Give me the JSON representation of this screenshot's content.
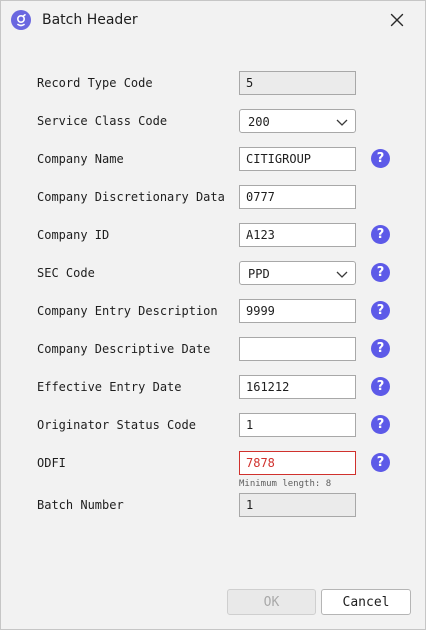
{
  "dialog": {
    "title": "Batch Header",
    "icon": "app-logo-icon",
    "close_icon": "close-icon"
  },
  "fields": {
    "record_type_code": {
      "label": "Record Type Code",
      "value": "5"
    },
    "service_class_code": {
      "label": "Service Class Code",
      "value": "200"
    },
    "company_name": {
      "label": "Company Name",
      "value": "CITIGROUP"
    },
    "company_discretionary_data": {
      "label": "Company Discretionary Data",
      "value": "0777"
    },
    "company_id": {
      "label": "Company ID",
      "value": "A123"
    },
    "sec_code": {
      "label": "SEC Code",
      "value": "PPD"
    },
    "company_entry_description": {
      "label": "Company Entry Description",
      "value": "9999"
    },
    "company_descriptive_date": {
      "label": "Company Descriptive Date",
      "value": ""
    },
    "effective_entry_date": {
      "label": "Effective Entry Date",
      "value": "161212"
    },
    "originator_status_code": {
      "label": "Originator Status Code",
      "value": "1"
    },
    "odfi": {
      "label": "ODFI",
      "value": "7878",
      "hint": "Minimum length: 8"
    },
    "batch_number": {
      "label": "Batch Number",
      "value": "1"
    }
  },
  "help_glyph": "?",
  "buttons": {
    "ok": "OK",
    "cancel": "Cancel"
  },
  "colors": {
    "accent": "#5d5ae8",
    "error": "#d0312d"
  }
}
